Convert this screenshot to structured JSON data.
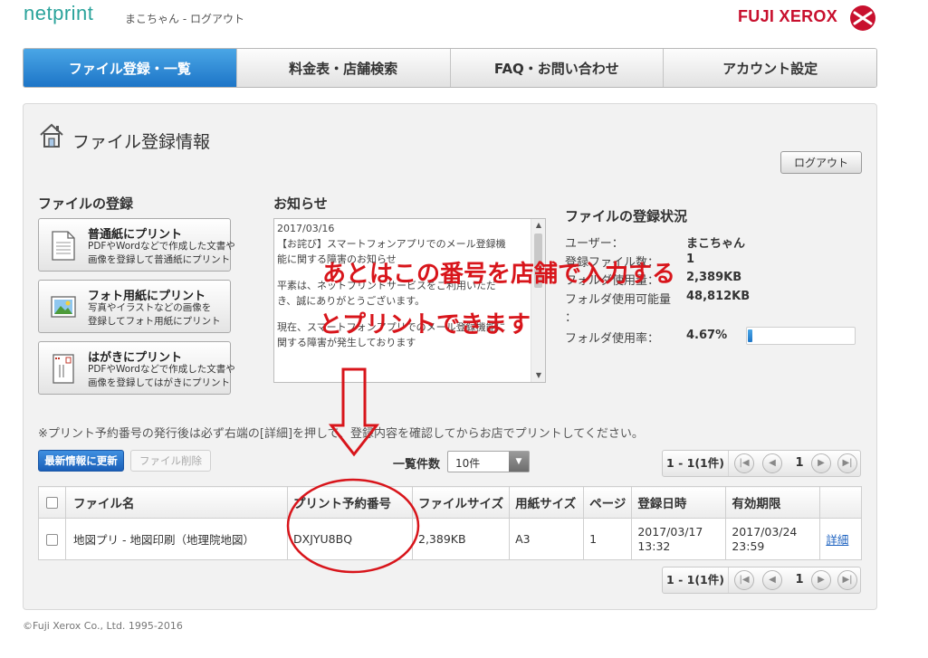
{
  "header": {
    "logo": "netprint",
    "user_name": "まこちゃん",
    "separator": " - ",
    "logout_link": "ログアウト",
    "brand": "FUJI XEROX",
    "brand_color": "#c8102e",
    "accent_color": "#2aa39b"
  },
  "tabs": [
    {
      "label": "ファイル登録・一覧",
      "active": true
    },
    {
      "label": "料金表・店舗検索",
      "active": false
    },
    {
      "label": "FAQ・お問い合わせ",
      "active": false
    },
    {
      "label": "アカウント設定",
      "active": false
    }
  ],
  "page": {
    "title": "ファイル登録情報",
    "logout_button": "ログアウト"
  },
  "file_register": {
    "title": "ファイルの登録",
    "buttons": [
      {
        "title": "普通紙にプリント",
        "desc1": "PDFやWordなどで作成した文書や",
        "desc2": "画像を登録して普通紙にプリント",
        "icon": "document-icon"
      },
      {
        "title": "フォト用紙にプリント",
        "desc1": "写真やイラストなどの画像を",
        "desc2": "登録してフォト用紙にプリント",
        "icon": "photo-icon"
      },
      {
        "title": "はがきにプリント",
        "desc1": "PDFやWordなどで作成した文書や",
        "desc2": "画像を登録してはがきにプリント",
        "icon": "postcard-icon"
      }
    ]
  },
  "news": {
    "title": "お知らせ",
    "date": "2017/03/16",
    "line1": "【お詫び】スマートフォンアプリでのメール登録機",
    "line2": "能に関する障害のお知らせ",
    "line3": "平素は、ネットプリントサービスをご利用いただ",
    "line4": "き、誠にありがとうございます。",
    "line5": "現在、スマートフォンアプリでのメール登録機能に",
    "line6": "関する障害が発生しております"
  },
  "status": {
    "title": "ファイルの登録状況",
    "user_label": "ユーザー：",
    "user_value": "まこちゃん",
    "files_label": "登録ファイル数：",
    "files_value": "1",
    "used_label": "フォルダ使用量：",
    "used_value": "2,389KB",
    "available_label": "フォルダ使用可能量",
    "available_value": "48,812KB",
    "available_colon": "：",
    "rate_label": "フォルダ使用率：",
    "rate_value": "4.67%",
    "rate_fraction": 0.0467
  },
  "notice": "※プリント予約番号の発行後は必ず右端の[詳細]を押して、登録内容を確認してからお店でプリントしてください。",
  "toolbar": {
    "refresh_button": "最新情報に更新",
    "delete_button": "ファイル削除",
    "count_label": "一覧件数",
    "count_value": "10件"
  },
  "pager": {
    "info": "1 - 1(1件)",
    "current_page": "1"
  },
  "table": {
    "headers": [
      "ファイル名",
      "プリント予約番号",
      "ファイルサイズ",
      "用紙サイズ",
      "ページ",
      "登録日時",
      "有効期限"
    ],
    "rows": [
      {
        "file_name": "地図プリ - 地図印刷（地理院地図）",
        "reservation": "DXJYU8BQ",
        "size": "2,389KB",
        "paper": "A3",
        "pages": "1",
        "registered_date": "2017/03/17",
        "registered_time": "13:32",
        "expiry_date": "2017/03/24",
        "expiry_time": "23:59",
        "detail": "詳細"
      }
    ]
  },
  "footer": {
    "copyright": "©Fuji Xerox Co., Ltd. 1995-2016"
  },
  "annotation": {
    "line1": "あとはこの番号を店舗で入力する",
    "line2": "とプリントできます",
    "color": "#d8151b"
  }
}
